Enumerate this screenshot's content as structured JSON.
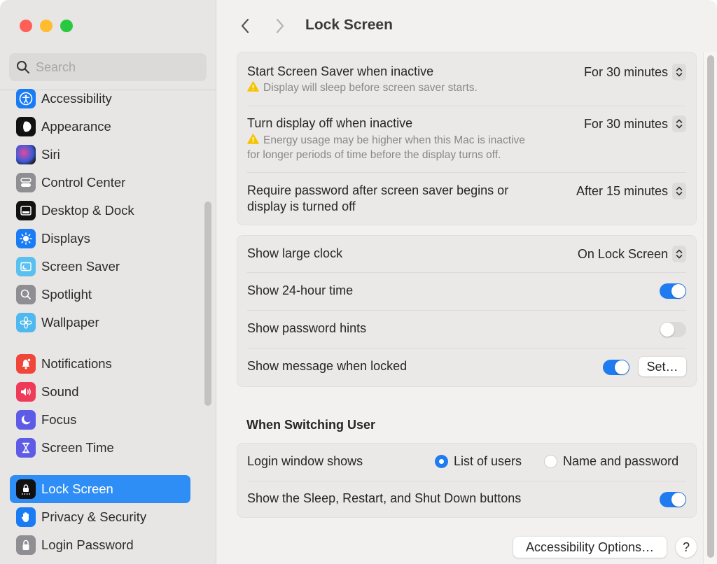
{
  "window": {
    "traffic_lights": [
      "close",
      "minimize",
      "zoom"
    ]
  },
  "sidebar": {
    "search": {
      "placeholder": "Search",
      "value": "",
      "icon": "search-icon"
    },
    "items": [
      {
        "label": "Accessibility",
        "icon": "accessibility-icon",
        "color": "#1a7cf5",
        "active": false
      },
      {
        "label": "Appearance",
        "icon": "appearance-icon",
        "color": "#111111",
        "active": false
      },
      {
        "label": "Siri",
        "icon": "siri-icon",
        "color": "#5a2a6a",
        "active": false
      },
      {
        "label": "Control Center",
        "icon": "control-center-icon",
        "color": "#8e8e93",
        "active": false
      },
      {
        "label": "Desktop & Dock",
        "icon": "desktop-dock-icon",
        "color": "#111111",
        "active": false
      },
      {
        "label": "Displays",
        "icon": "displays-icon",
        "color": "#1a7cf5",
        "active": false
      },
      {
        "label": "Screen Saver",
        "icon": "screen-saver-icon",
        "color": "#5ac0f0",
        "active": false
      },
      {
        "label": "Spotlight",
        "icon": "spotlight-icon",
        "color": "#8e8e93",
        "active": false
      },
      {
        "label": "Wallpaper",
        "icon": "wallpaper-icon",
        "color": "#4fb8ee",
        "active": false
      },
      {
        "label": "Notifications",
        "icon": "notifications-icon",
        "color": "#f0463a",
        "active": false
      },
      {
        "label": "Sound",
        "icon": "sound-icon",
        "color": "#f03a5a",
        "active": false
      },
      {
        "label": "Focus",
        "icon": "focus-icon",
        "color": "#5e5ce6",
        "active": false
      },
      {
        "label": "Screen Time",
        "icon": "screen-time-icon",
        "color": "#5e5ce6",
        "active": false
      },
      {
        "label": "Lock Screen",
        "icon": "lock-screen-icon",
        "color": "#111111",
        "active": true
      },
      {
        "label": "Privacy & Security",
        "icon": "privacy-hand-icon",
        "color": "#1a7cf5",
        "active": false
      },
      {
        "label": "Login Password",
        "icon": "login-password-icon",
        "color": "#8e8e93",
        "active": false
      }
    ]
  },
  "header": {
    "title": "Lock Screen",
    "back_icon": "chevron-left-icon",
    "forward_icon": "chevron-right-icon"
  },
  "group1": {
    "rows": [
      {
        "label": "Start Screen Saver when inactive",
        "warning": "Display will sleep before screen saver starts.",
        "value": "For 30 minutes"
      },
      {
        "label": "Turn display off when inactive",
        "warning_line1": "Energy usage may be higher when this Mac is inactive",
        "warning_line2": "for longer periods of time before the display turns off.",
        "value": "For 30 minutes"
      },
      {
        "label_line1": "Require password after screen saver begins or",
        "label_line2": "display is turned off",
        "value": "After 15 minutes"
      }
    ]
  },
  "group2": {
    "rows": [
      {
        "label": "Show large clock",
        "value": "On Lock Screen"
      },
      {
        "label": "Show 24-hour time",
        "toggle": true
      },
      {
        "label": "Show password hints",
        "toggle": false
      },
      {
        "label": "Show message when locked",
        "toggle": true,
        "button": "Set…"
      }
    ]
  },
  "switching": {
    "title": "When Switching User",
    "login_window": {
      "label": "Login window shows",
      "options": [
        {
          "label": "List of users",
          "selected": true
        },
        {
          "label": "Name and password",
          "selected": false
        }
      ]
    },
    "sleep_buttons": {
      "label": "Show the Sleep, Restart, and Shut Down buttons",
      "toggle": true
    }
  },
  "footer": {
    "accessibility_button": "Accessibility Options…",
    "help_button": "?"
  },
  "colors": {
    "accent": "#1f7bf0",
    "sidebar_selection": "#2f8ef5",
    "warning": "#f5c400"
  }
}
